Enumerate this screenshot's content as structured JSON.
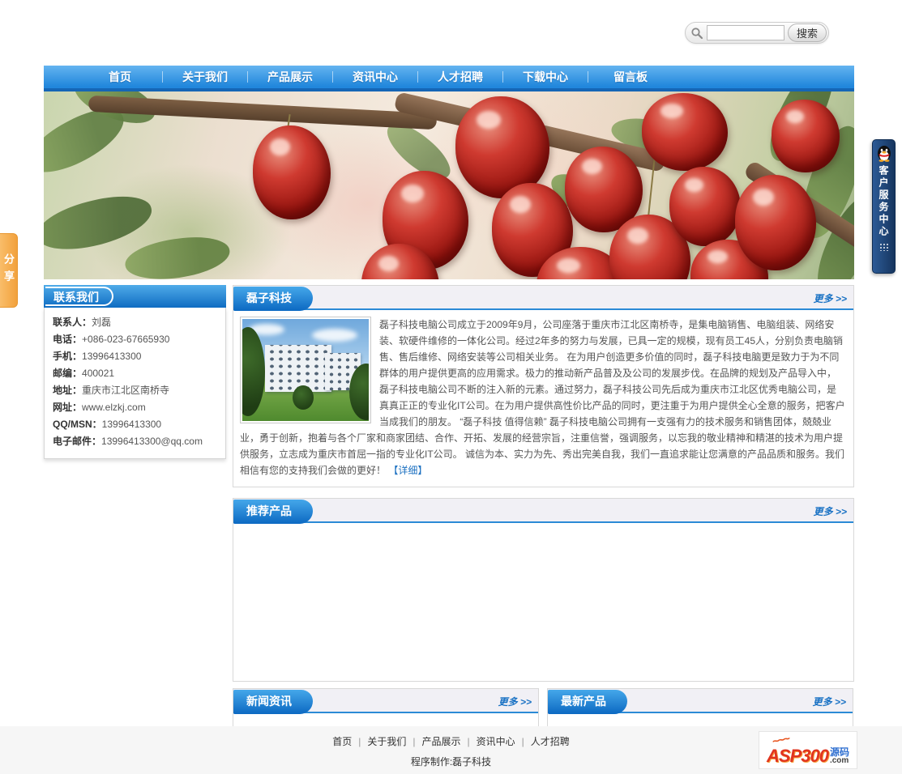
{
  "search": {
    "value": "",
    "button_label": "搜索"
  },
  "nav": {
    "items": [
      "首页",
      "关于我们",
      "产品展示",
      "资讯中心",
      "人才招聘",
      "下载中心",
      "留言板"
    ]
  },
  "share_tab": {
    "label": "分享"
  },
  "service_tab": {
    "label": "客户服务中心"
  },
  "sidebar": {
    "title": "联系我们",
    "fields": [
      {
        "label": "联系人：",
        "value": "刘磊"
      },
      {
        "label": "电话：",
        "value": "+086-023-67665930"
      },
      {
        "label": "手机：",
        "value": "13996413300"
      },
      {
        "label": "邮编：",
        "value": "400021"
      },
      {
        "label": "地址：",
        "value": "重庆市江北区南桥寺"
      },
      {
        "label": "网址：",
        "value": "www.elzkj.com"
      },
      {
        "label": "QQ/MSN：",
        "value": "13996413300"
      },
      {
        "label": "电子邮件：",
        "value": "13996413300@qq.com"
      }
    ]
  },
  "about": {
    "title": "磊子科技",
    "more_label": "更多 >>",
    "text": "磊子科技电脑公司成立于2009年9月，公司座落于重庆市江北区南桥寺，是集电脑销售、电脑组装、网络安装、软硬件维修的一体化公司。经过2年多的努力与发展，已具一定的规模，现有员工45人，分别负责电脑销售、售后维修、网络安装等公司相关业务。 在为用户创造更多价值的同时，磊子科技电脑更是致力于为不同群体的用户提供更高的应用需求。极力的推动新产品普及及公司的发展步伐。在品牌的规划及产品导入中，磊子科技电脑公司不断的注入新的元素。通过努力，磊子科技公司先后成为重庆市江北区优秀电脑公司，是真真正正的专业化IT公司。在为用户提供高性价比产品的同时，更注重于为用户提供全心全意的服务，把客户当成我们的朋友。 “磊子科技 值得信赖” 磊子科技电脑公司拥有一支强有力的技术服务和销售团体，兢兢业业，勇于创新，抱着与各个厂家和商家团结、合作、开拓、发展的经营宗旨，注重信誉，强调服务，以忘我的敬业精神和精湛的技术为用户提供服务，立志成为重庆市首屈一指的专业化IT公司。 诚信为本、实力为先、秀出完美自我，我们一直追求能让您满意的产品品质和服务。我们相信有您的支持我们会做的更好！",
    "detail_link": "【详细】"
  },
  "recommended": {
    "title": "推荐产品",
    "more_label": "更多 >>"
  },
  "news": {
    "title": "新闻资讯",
    "more_label": "更多 >>"
  },
  "latest": {
    "title": "最新产品",
    "more_label": "更多 >>"
  },
  "footer": {
    "links": [
      "首页",
      "关于我们",
      "产品展示",
      "资讯中心",
      "人才招聘"
    ],
    "separator": "|",
    "credit": "程序制作:磊子科技"
  },
  "logo_badge": {
    "text_main": "ASP300",
    "text_cn": "源码",
    "text_com": ".com",
    "flame": "~~~"
  },
  "colors": {
    "nav_blue_top": "#64b4f0",
    "nav_blue_bottom": "#2187dc",
    "nav_strip": "#1566b6",
    "tab_blue_top": "#45a7ea",
    "tab_blue_bottom": "#0c69c2",
    "header_bar_bg": "#f1f0f5",
    "header_blue_line": "#2b8ad6",
    "more_link": "#1a72c4",
    "share_orange": "#f2a13c",
    "service_navy": "#16355e",
    "footer_bg": "#f6f6f6",
    "cherry_red": "#94130e"
  }
}
